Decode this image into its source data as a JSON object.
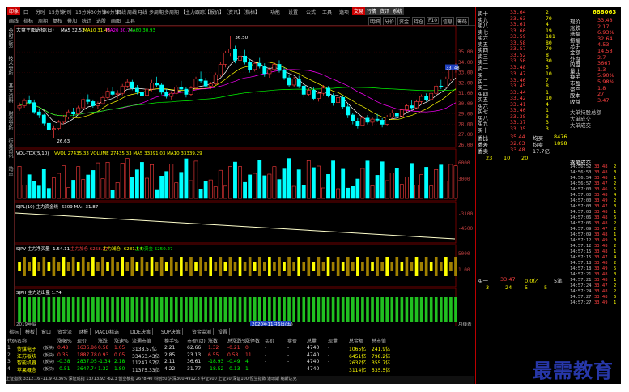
{
  "menubar": {
    "logo": "印象",
    "items": [
      "口",
      "分时",
      "15分钟",
      "分时",
      "15分钟",
      "30分钟",
      "60分钟",
      "日线",
      "周线",
      "月线",
      "多周期",
      "多周期",
      "【主力跟踪】",
      "【报价】",
      "【资讯】",
      "【指标】",
      "功能",
      "设置",
      "公式",
      "工具",
      "选项",
      "帮助"
    ],
    "right_badges": [
      "交易",
      "行情",
      "资讯",
      "系统"
    ]
  },
  "toolbar": {
    "items": [
      "画线",
      "指标",
      "周期",
      "复权",
      "叠加",
      "统计",
      "选股",
      "画图",
      "工具"
    ],
    "right_items": [
      "明细",
      "分价",
      "资金",
      "持仓",
      "F10",
      "信息",
      "筹码"
    ]
  },
  "left_tabs": [
    "分时走势",
    "技术分析",
    "基本资料",
    "财务分析",
    "行业资讯",
    "热点"
  ],
  "chart": {
    "main_label": "大盘主图选择(日)",
    "ma_labels": [
      {
        "text": "MA5 32.53",
        "color": "#ffffff"
      },
      {
        "text": "MA10 31.43",
        "color": "#ffff00"
      },
      {
        "text": "MA20 30.74",
        "color": "#ff00ff"
      },
      {
        "text": "MA60 30.93",
        "color": "#00ff00"
      }
    ],
    "y_labels": [
      "35.00",
      "34.00",
      "33.00",
      "32.00",
      "31.00",
      "30.00",
      "29.00",
      "28.00",
      "27.00",
      "26.00"
    ],
    "current_price_tag": "33.48",
    "high_label": "36.50",
    "low_label": "26.63",
    "vol_label": "VOL-TDX(5,10)",
    "vol_values": "VVOL 27435.33  VOLUME 27435.33  MA5 33391.03  MA10 33339.29",
    "vol_y": [
      "6000",
      "3000"
    ],
    "sub1_label": "SJPL(10) 主力资金线 -6309 MA: -31.87",
    "sub1_y": [
      "-3100",
      "-4500"
    ],
    "sub2_label": "SJPV 主力净买量 -1.54.11",
    "sub2_legend": [
      "主力加仓 6258.27",
      "主力减仓 -6281.54",
      "主力资金 5250.27"
    ],
    "sub2_y": [
      "5000",
      "1.00"
    ],
    "sub3_label": "SJPH 主力进出量 1.74",
    "date_label": "2020年11月6日(五)",
    "x_start": "2019年底",
    "x_end": "月线表"
  },
  "chart_data": [
    {
      "type": "candlestick",
      "title": "大盘主图选择(日)",
      "ylim": [
        26,
        36.5
      ],
      "series": [
        {
          "name": "MA5",
          "values": [
            32.53
          ]
        },
        {
          "name": "MA10",
          "values": [
            31.43
          ]
        },
        {
          "name": "MA20",
          "values": [
            30.74
          ]
        },
        {
          "name": "MA60",
          "values": [
            30.93
          ]
        }
      ],
      "candles": [
        [
          29.6,
          30.1,
          29.3,
          29.8
        ],
        [
          29.8,
          30.5,
          29.6,
          30.3
        ],
        [
          30.3,
          30.8,
          29.9,
          30.1
        ],
        [
          30.1,
          30.4,
          29.0,
          29.2
        ],
        [
          29.2,
          29.5,
          28.6,
          28.9
        ],
        [
          28.9,
          29.0,
          27.9,
          28.1
        ],
        [
          28.1,
          28.4,
          27.2,
          27.5
        ],
        [
          27.5,
          27.9,
          26.7,
          27.6
        ],
        [
          27.6,
          28.4,
          27.4,
          28.2
        ],
        [
          28.2,
          28.9,
          28.0,
          28.7
        ],
        [
          28.7,
          29.4,
          28.5,
          29.2
        ],
        [
          29.2,
          29.6,
          28.8,
          29.0
        ],
        [
          29.0,
          29.8,
          28.9,
          29.6
        ],
        [
          29.6,
          30.6,
          29.4,
          30.4
        ],
        [
          30.4,
          30.9,
          29.9,
          30.2
        ],
        [
          30.2,
          30.4,
          29.6,
          29.8
        ],
        [
          29.8,
          30.2,
          29.5,
          30.0
        ],
        [
          30.0,
          30.8,
          29.9,
          30.6
        ],
        [
          30.6,
          31.5,
          30.4,
          31.2
        ],
        [
          31.2,
          31.6,
          30.7,
          30.9
        ],
        [
          30.9,
          31.3,
          30.5,
          31.0
        ],
        [
          31.0,
          31.9,
          30.8,
          31.7
        ],
        [
          31.7,
          32.4,
          31.5,
          32.1
        ],
        [
          32.1,
          32.3,
          31.3,
          31.5
        ],
        [
          31.5,
          31.8,
          30.9,
          31.1
        ],
        [
          31.1,
          31.4,
          30.6,
          30.8
        ],
        [
          30.8,
          31.6,
          30.6,
          31.4
        ],
        [
          31.4,
          32.3,
          31.2,
          32.0
        ],
        [
          32.0,
          32.6,
          31.6,
          31.8
        ],
        [
          31.8,
          32.0,
          30.9,
          31.1
        ],
        [
          31.1,
          31.4,
          30.5,
          30.7
        ],
        [
          30.7,
          31.2,
          30.4,
          31.0
        ],
        [
          31.0,
          31.8,
          30.9,
          31.6
        ],
        [
          31.6,
          32.2,
          31.3,
          31.4
        ],
        [
          31.4,
          31.6,
          30.6,
          30.9
        ],
        [
          30.9,
          31.7,
          30.7,
          31.5
        ],
        [
          31.5,
          32.6,
          31.3,
          32.4
        ],
        [
          32.4,
          33.1,
          32.0,
          32.2
        ],
        [
          32.2,
          32.5,
          31.5,
          31.7
        ],
        [
          31.7,
          32.1,
          31.4,
          31.9
        ],
        [
          31.9,
          33.0,
          31.8,
          32.8
        ],
        [
          32.8,
          34.0,
          32.6,
          33.8
        ],
        [
          33.8,
          35.1,
          33.5,
          34.9
        ],
        [
          34.9,
          36.5,
          34.6,
          35.3
        ],
        [
          35.3,
          35.6,
          33.9,
          34.2
        ],
        [
          34.2,
          34.8,
          33.6,
          34.6
        ],
        [
          34.6,
          35.2,
          33.8,
          34.0
        ],
        [
          34.0,
          34.3,
          33.0,
          33.3
        ],
        [
          33.3,
          34.1,
          33.1,
          33.9
        ],
        [
          33.9,
          34.5,
          33.4,
          33.6
        ],
        [
          33.6,
          33.9,
          32.6,
          32.9
        ],
        [
          32.9,
          33.5,
          32.5,
          33.3
        ],
        [
          33.3,
          34.0,
          33.1,
          33.8
        ],
        [
          33.8,
          34.2,
          33.0,
          33.2
        ],
        [
          33.2,
          33.5,
          32.3,
          32.5
        ],
        [
          32.5,
          32.8,
          31.6,
          31.8
        ],
        [
          31.8,
          32.6,
          31.6,
          32.4
        ],
        [
          32.4,
          32.7,
          31.5,
          31.7
        ],
        [
          31.7,
          32.0,
          30.6,
          30.9
        ],
        [
          30.9,
          31.5,
          30.7,
          31.3
        ],
        [
          31.3,
          31.6,
          30.3,
          30.5
        ],
        [
          30.5,
          31.2,
          30.2,
          31.0
        ],
        [
          31.0,
          31.8,
          30.8,
          31.5
        ],
        [
          31.5,
          31.7,
          30.6,
          30.8
        ],
        [
          30.8,
          31.0,
          29.8,
          30.1
        ],
        [
          30.1,
          30.9,
          29.9,
          30.6
        ],
        [
          30.6,
          30.8,
          29.5,
          29.7
        ],
        [
          29.7,
          30.0,
          28.6,
          28.9
        ],
        [
          28.9,
          29.1,
          28.0,
          28.3
        ],
        [
          28.3,
          28.6,
          27.6,
          27.9
        ],
        [
          27.9,
          28.8,
          27.8,
          28.6
        ],
        [
          28.6,
          28.9,
          28.0,
          28.2
        ],
        [
          28.2,
          28.7,
          27.9,
          28.5
        ],
        [
          28.5,
          29.0,
          28.2,
          28.4
        ],
        [
          28.4,
          28.6,
          27.7,
          28.0
        ],
        [
          28.0,
          28.9,
          27.9,
          28.7
        ],
        [
          28.7,
          29.4,
          28.5,
          29.1
        ],
        [
          29.1,
          29.3,
          28.6,
          28.8
        ],
        [
          28.8,
          29.6,
          28.7,
          29.4
        ],
        [
          29.4,
          30.0,
          29.2,
          29.8
        ],
        [
          29.8,
          30.3,
          29.4,
          29.6
        ],
        [
          29.6,
          30.4,
          29.5,
          30.2
        ],
        [
          30.2,
          30.9,
          30.0,
          30.7
        ],
        [
          30.7,
          31.0,
          30.2,
          30.4
        ],
        [
          30.4,
          31.2,
          30.3,
          31.0
        ],
        [
          31.0,
          31.9,
          30.8,
          31.7
        ],
        [
          31.7,
          32.3,
          31.4,
          31.6
        ],
        [
          31.6,
          32.6,
          31.5,
          32.4
        ],
        [
          32.4,
          33.5,
          32.2,
          33.3
        ],
        [
          33.3,
          33.9,
          33.0,
          33.48
        ]
      ]
    }
  ],
  "right_panel": {
    "sell_rows": [
      {
        "label": "卖十",
        "price": "33.64",
        "vol": "2"
      },
      {
        "label": "卖九",
        "price": "33.63",
        "vol": "70"
      },
      {
        "label": "卖八",
        "price": "33.61",
        "vol": "4"
      },
      {
        "label": "卖七",
        "price": "33.60",
        "vol": "19"
      },
      {
        "label": "卖六",
        "price": "33.59",
        "vol": "181"
      },
      {
        "label": "卖五",
        "price": "33.58",
        "vol": "80"
      },
      {
        "label": "卖四",
        "price": "33.57",
        "vol": "70"
      },
      {
        "label": "卖三",
        "price": "33.52",
        "vol": "8"
      },
      {
        "label": "卖二",
        "price": "33.50",
        "vol": "30"
      },
      {
        "label": "卖一",
        "price": "33.48",
        "vol": "5"
      }
    ],
    "buy_rows": [
      {
        "label": "买一",
        "price": "33.47",
        "vol": "10"
      },
      {
        "label": "买二",
        "price": "33.46",
        "vol": "7"
      },
      {
        "label": "买三",
        "price": "33.45",
        "vol": "8"
      },
      {
        "label": "买四",
        "price": "33.44",
        "vol": "1"
      },
      {
        "label": "买五",
        "price": "33.42",
        "vol": "10"
      },
      {
        "label": "买六",
        "price": "33.41",
        "vol": "4"
      },
      {
        "label": "买七",
        "price": "33.40",
        "vol": "1"
      },
      {
        "label": "买八",
        "price": "33.38",
        "vol": "3"
      },
      {
        "label": "买九",
        "price": "33.37",
        "vol": "3"
      },
      {
        "label": "买十",
        "price": "33.35",
        "vol": "3"
      }
    ],
    "avg_rows": [
      {
        "label": "委比",
        "value1": "35.44",
        "label2": "均买",
        "value2": "8476"
      },
      {
        "label": "委差",
        "value1": "32.63",
        "label2": "均卖",
        "value2": "1898"
      },
      {
        "label": "委卖",
        "value1": "33.48",
        "label2": "17.7亿",
        "value2": ""
      }
    ],
    "quick_row": [
      "23",
      "10",
      "20"
    ],
    "quote_code": "688063",
    "quote_items": [
      {
        "label": "现价",
        "value": "33.48"
      },
      {
        "label": "涨跌",
        "value": "2.17"
      },
      {
        "label": "涨幅",
        "value": "6.93%"
      },
      {
        "label": "振幅",
        "value": "32.64"
      },
      {
        "label": "总手",
        "value": "4.53"
      },
      {
        "label": "金额",
        "value": "14.58"
      },
      {
        "label": "外盘",
        "value": "2.7"
      },
      {
        "label": "内盘",
        "value": "3667"
      },
      {
        "label": "量比",
        "value": "1.3"
      },
      {
        "label": "换手",
        "value": "5.90%"
      },
      {
        "label": "市盈",
        "value": "5.98%"
      },
      {
        "label": "资产",
        "value": "1.8"
      },
      {
        "label": "股本",
        "value": "27"
      },
      {
        "label": "收益",
        "value": "3.47"
      }
    ],
    "notice": [
      "大单持股总额",
      "大单成交",
      "大单成交"
    ],
    "trade_list_title": "逐笔成交",
    "trades": [
      {
        "t": "14:56:52",
        "p": "33.48",
        "v": "2"
      },
      {
        "t": "14:56:53",
        "p": "33.48",
        "v": "3"
      },
      {
        "t": "14:56:54",
        "p": "33.48",
        "v": "1"
      },
      {
        "t": "14:56:57",
        "p": "33.47",
        "v": "2"
      },
      {
        "t": "14:57:00",
        "p": "33.46",
        "v": "5"
      },
      {
        "t": "14:57:00",
        "p": "33.48",
        "v": "4"
      },
      {
        "t": "14:57:00",
        "p": "33.49",
        "v": "2"
      },
      {
        "t": "14:57:03",
        "p": "33.47",
        "v": "3"
      },
      {
        "t": "14:57:03",
        "p": "33.48",
        "v": "1"
      },
      {
        "t": "14:57:06",
        "p": "33.48",
        "v": "6"
      },
      {
        "t": "14:57:06",
        "p": "33.48",
        "v": "2"
      },
      {
        "t": "14:57:09",
        "p": "33.47",
        "v": "2"
      },
      {
        "t": "14:57:09",
        "p": "33.48",
        "v": "1"
      },
      {
        "t": "14:57:12",
        "p": "33.49",
        "v": "3"
      },
      {
        "t": "14:57:12",
        "p": "33.48",
        "v": "2"
      },
      {
        "t": "14:57:15",
        "p": "33.48",
        "v": "1"
      },
      {
        "t": "14:57:15",
        "p": "33.47",
        "v": "4"
      },
      {
        "t": "14:57:18",
        "p": "33.48",
        "v": "2"
      },
      {
        "t": "14:57:18",
        "p": "33.49",
        "v": "5"
      },
      {
        "t": "14:57:21",
        "p": "33.48",
        "v": "3"
      },
      {
        "t": "14:57:21",
        "p": "33.48",
        "v": "1"
      },
      {
        "t": "14:57:24",
        "p": "33.47",
        "v": "2"
      },
      {
        "t": "14:57:24",
        "p": "33.48",
        "v": "2"
      },
      {
        "t": "14:57:27",
        "p": "33.48",
        "v": "6"
      },
      {
        "t": "14:57:27",
        "p": "33.49",
        "v": "1"
      }
    ],
    "bottom_row": {
      "label": "买一",
      "price": "33.47",
      "vol": "0.0亿",
      "extra": "5笔"
    },
    "bottom_nums": [
      "3",
      "24",
      "5",
      "5"
    ]
  },
  "bottom": {
    "tabs": [
      "指标",
      "模板",
      "窗口",
      "资金流",
      "财报",
      "MACD精选",
      "DDE决策",
      "SUP决策",
      "资金监测",
      "设置"
    ],
    "headers": [
      "代码",
      "名称",
      "涨幅%",
      "现价",
      "涨跌",
      "涨速%",
      "流通市值",
      "换手%",
      "市盈(动)",
      "涨数",
      "总涨跌%",
      "涨停数",
      "买价",
      "卖价",
      "总量",
      "现量",
      "总金额",
      "总市值"
    ],
    "rows": [
      {
        "idx": "1",
        "name": "传媒电子",
        "tag": "(板块)",
        "pct": "0.48",
        "price": "1636.86",
        "chg": "0.58",
        "spd": "1.05",
        "cap": "3138.57亿",
        "turn": "2.21",
        "pe": "62.66",
        "up": "1.32",
        "tot": "-0.21",
        "lim": "0",
        "bid": "-",
        "ask": "-",
        "vol": "4740",
        "cur": "-",
        "amt": "1065亿",
        "mcap": "241.9亿"
      },
      {
        "idx": "2",
        "name": "江苏板块",
        "tag": "(板块)",
        "pct": "0.35",
        "price": "1887.78",
        "chg": "0.93",
        "spd": "0.05",
        "cap": "33453.43亿",
        "turn": "2.85",
        "pe": "23.13",
        "up": "6.55",
        "tot": "0.58",
        "lim": "11",
        "bid": "-",
        "ask": "-",
        "vol": "4740",
        "cur": "-",
        "amt": "6451亿",
        "mcap": "798.2亿"
      },
      {
        "idx": "3",
        "name": "智能机器",
        "tag": "(板块)",
        "pct": "-0.38",
        "price": "2837.05",
        "chg": "-1.34",
        "spd": "2.18",
        "cap": "11247.57亿",
        "turn": "2.11",
        "pe": "36.61",
        "up": "-18.93",
        "tot": "-0.49",
        "lim": "4",
        "bid": "-",
        "ask": "-",
        "vol": "4740",
        "cur": "-",
        "amt": "2637亿",
        "mcap": "355.7亿"
      },
      {
        "idx": "4",
        "name": "苹果概念",
        "tag": "(板块)",
        "pct": "-0.51",
        "price": "3647.74",
        "chg": "1.32",
        "spd": "1.80",
        "cap": "11375.33亿",
        "turn": "4.22",
        "pe": "31.77",
        "up": "-18.52",
        "tot": "-0.13",
        "lim": "1",
        "bid": "-",
        "ask": "-",
        "vol": "4740",
        "cur": "-",
        "amt": "3114亿",
        "mcap": "535.5亿"
      }
    ]
  },
  "statusbar": {
    "text": "上证指数 3312.16 -11.9 -0.36%  深证成指 13713.92 -62.3  创业板指 2678.40  科创50  沪深300 4912.8  中证500  上证50  深证100  恒生指数  道琼斯  纳斯达克"
  },
  "watermark": "最需教育",
  "colors": {
    "up": "#ff3c3c",
    "down": "#00ffff",
    "ma5": "#ffffff",
    "ma10": "#ffff00",
    "ma20": "#ff00ff",
    "ma60": "#00ff00",
    "grid": "#8b0000"
  }
}
